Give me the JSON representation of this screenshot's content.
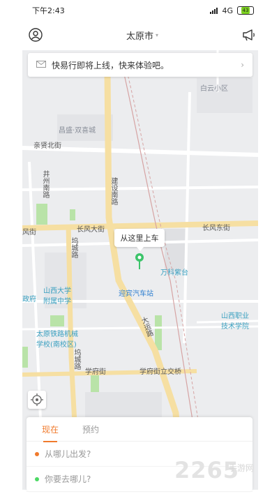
{
  "statusbar": {
    "time": "下午2:43",
    "network": "4G",
    "battery": "43"
  },
  "appbar": {
    "city": "太原市",
    "left_icon": "user-icon",
    "right_icon": "megaphone-icon"
  },
  "notice": {
    "text": "快易行即将上线，快来体验吧。",
    "icon": "mail-icon"
  },
  "map": {
    "pickup_bubble": "从这里上车",
    "labels": {
      "baiyun": "白云小区",
      "changsheng": "昌盛·双喜城",
      "qinxian": "亲贤北街",
      "jingzhou": "井州南路",
      "jianshe": "建设南路",
      "changfeng_w": "长风大街",
      "changfeng_e": "长风东街",
      "feng": "风街",
      "wucheng1": "坞城路",
      "wanke": "万科紫台",
      "shanxi_univ": "山西大学附属中学",
      "zhengfu": "政府",
      "yingbin": "迎宾汽车站",
      "shanxi_vocational": "山西职业技术学院",
      "taiyuan_rail": "太原铁路机械学校(南校区)",
      "dayun": "大运路",
      "wucheng2": "坞城路",
      "xuefu": "学府街",
      "xuefu_bridge": "学府街立交桥"
    }
  },
  "panel": {
    "tabs": [
      "现在",
      "预约"
    ],
    "from_placeholder": "从哪儿出发?",
    "to_placeholder": "你要去哪儿?",
    "colors": {
      "accent": "#f07a2c",
      "from_dot": "#f07a2c",
      "to_dot": "#4cd964"
    }
  },
  "watermark": {
    "number": "2265",
    "site": "手游网"
  }
}
